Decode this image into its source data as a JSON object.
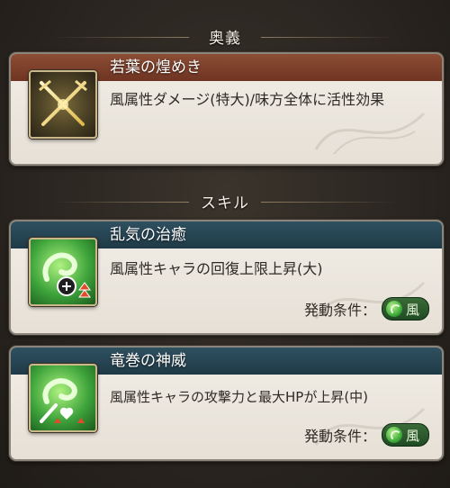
{
  "sections": {
    "ougi_header": "奥義",
    "skill_header": "スキル"
  },
  "ougi": {
    "name": "若葉の煌めき",
    "description": "風属性ダメージ(特大)/味方全体に活性効果",
    "icon": "crossed-swords-icon"
  },
  "skills": [
    {
      "name": "乱気の治癒",
      "description": "風属性キャラの回復上限上昇(大)",
      "condition_label": "発動条件：",
      "element_badge": "風",
      "icon": "wind-heal-cap-up-icon"
    },
    {
      "name": "竜巻の神威",
      "description": "風属性キャラの攻撃力と最大HPが上昇(中)",
      "condition_label": "発動条件：",
      "element_badge": "風",
      "icon": "wind-atk-hp-up-icon"
    }
  ],
  "colors": {
    "ougi_title": "#8c4d35",
    "skill_title": "#2f5060",
    "wind_badge": "#2f5e2f"
  }
}
